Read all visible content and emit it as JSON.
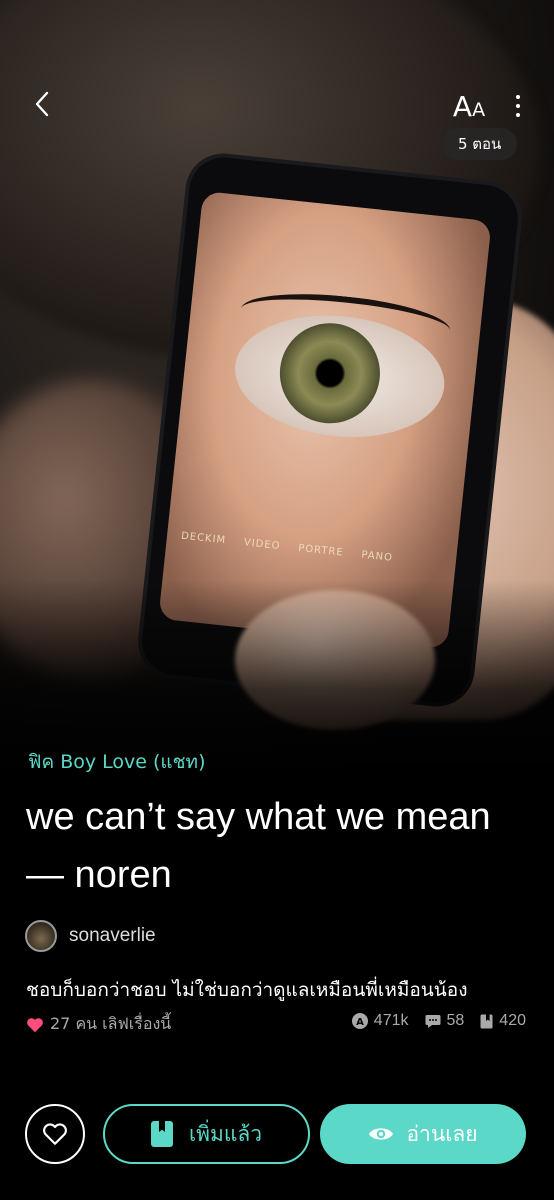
{
  "header": {
    "font_size_label_big": "A",
    "font_size_label_small": "A",
    "episode_count": "5 ตอน"
  },
  "cover": {
    "camera_modes": [
      "DECKIM",
      "VIDEO",
      "PORTRE",
      "PANO"
    ]
  },
  "story": {
    "category": "ฟิค Boy Love (แชท)",
    "title": "we can’t say what we mean — noren",
    "author": "sonaverlie",
    "tagline": "ชอบก็บอกว่าชอบ ไม่ใช่บอกว่าดูแลเหมือนพี่เหมือนน้อง",
    "likes_text": "27 คน เลิฟเรื่องนี้",
    "stats": {
      "views": "471k",
      "comments": "58",
      "bookmarks": "420"
    }
  },
  "actions": {
    "library_label": "เพิ่มแล้ว",
    "read_label": "อ่านเลย"
  },
  "colors": {
    "accent": "#5cd8c8",
    "heart": "#ff4d7d",
    "background": "#000000"
  },
  "icons": {
    "back": "chevron-left-icon",
    "more": "more-vertical-icon",
    "like": "heart-icon",
    "views": "reads-icon",
    "comments": "comment-icon",
    "bookmarks": "bookmark-icon",
    "favorite": "heart-outline-icon",
    "library": "book-icon",
    "read": "eye-icon"
  }
}
